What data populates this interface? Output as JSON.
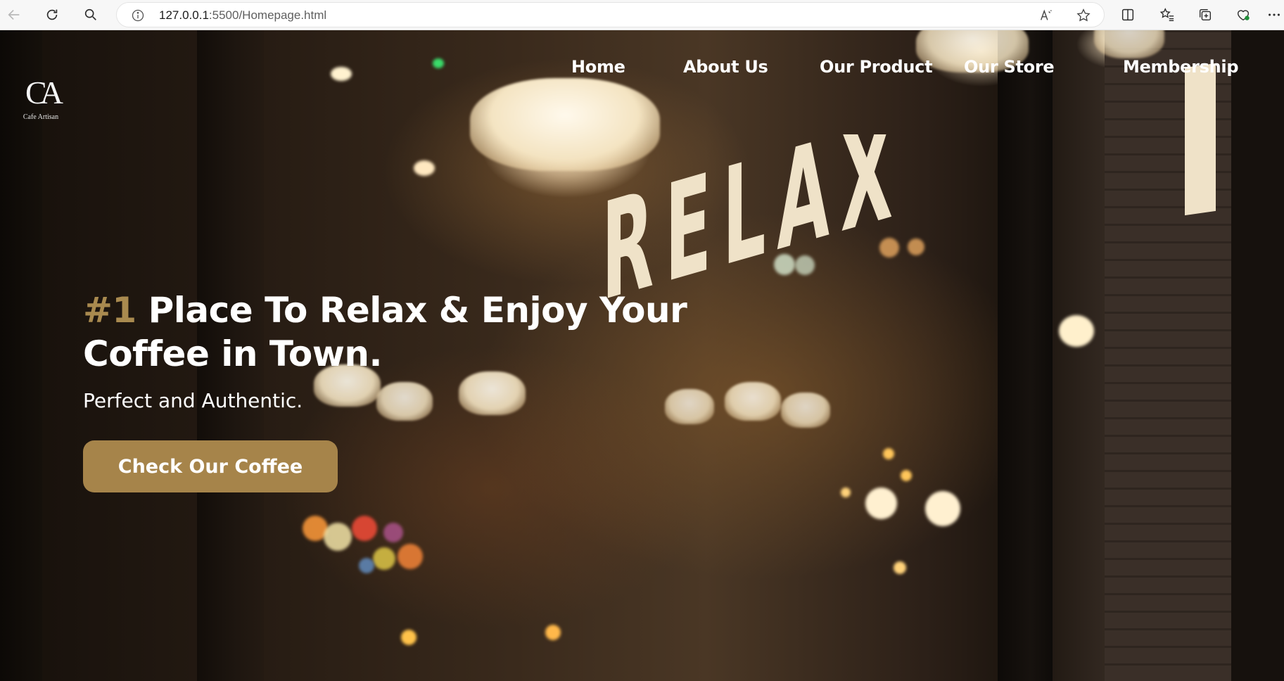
{
  "browser": {
    "url_host": "127.0.0.1",
    "url_rest": ":5500/Homepage.html",
    "back_icon": "arrow-left-icon",
    "reload_icon": "reload-icon",
    "search_icon": "search-icon",
    "info_icon": "info-icon",
    "read_aloud_icon": "read-aloud-icon",
    "favorite_icon": "star-icon",
    "split_icon": "split-screen-icon",
    "favorites_icon": "favorites-list-icon",
    "collections_icon": "collections-icon",
    "health_icon": "browser-essentials-icon",
    "more_icon": "more-icon"
  },
  "header": {
    "logo_mark": "CA",
    "logo_name": "Cafe Artisan",
    "nav": [
      "Home",
      "About Us",
      "Our Product",
      "Our Store",
      "Membership"
    ]
  },
  "hero": {
    "headline_accent": "#1",
    "headline_line1": "Place To Relax & Enjoy Your",
    "headline_line2": "Coffee in Town.",
    "subtitle": "Perfect and Authentic.",
    "cta_label": "Check Our Coffee",
    "window_sign": "RELAX"
  },
  "colors": {
    "accent": "#a98a4f",
    "button": "#a6844a"
  }
}
